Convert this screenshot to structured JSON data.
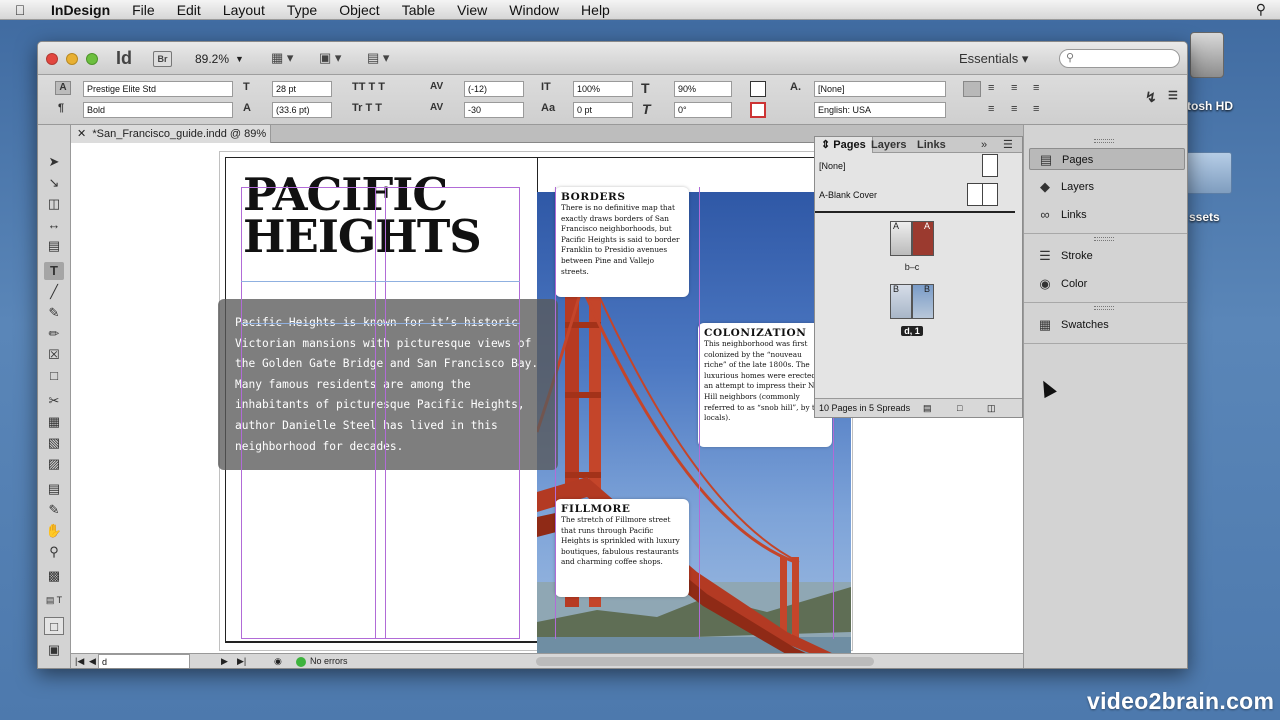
{
  "menubar": {
    "app": "InDesign",
    "items": [
      "File",
      "Edit",
      "Layout",
      "Type",
      "Object",
      "Table",
      "View",
      "Window",
      "Help"
    ]
  },
  "desktop": {
    "hd_label": "tosh HD",
    "folder_label": "ssets",
    "watermark": "video2brain.com"
  },
  "appbar": {
    "logo": "Id",
    "bridge": "Br",
    "zoom": "89.2%",
    "workspace": "Essentials",
    "search_placeholder": ""
  },
  "control": {
    "font_family": "Prestige Elite Std",
    "font_style": "Bold",
    "font_size": "28 pt",
    "leading": "(33.6 pt)",
    "kerning": "(-12)",
    "tracking": "-30",
    "vscale": "100%",
    "baseline": "0 pt",
    "hscale": "90%",
    "skew": "0°",
    "char_style": "[None]",
    "language": "English: USA"
  },
  "document": {
    "tab": "*San_Francisco_guide.indd @ 89%",
    "heading_line1": "PACIFIC",
    "heading_line2": "HEIGHTS",
    "intro": "Pacific Heights is known for it’s historic Victorian mansions with picturesque views of the Golden Gate Bridge and San Francisco Bay. Many famous residents are among the inhabitants of picturesque Pacific Heights, author Danielle Steel has lived in this neighborhood for decades.",
    "callouts": [
      {
        "title": "BORDERS",
        "body": "There is no definitive map that exactly draws borders of San Francisco neighborhoods, but Pacific Heights is said to border Franklin to Presidio avenues between Pine and Vallejo streets."
      },
      {
        "title": "COLONIZATION",
        "body": "This neighborhood was first colonized by the “nouveau riche” of the late 1800s. The luxurious homes were erected in an attempt to impress their Nob Hill neighbors (commonly referred to as “snob hill”, by the locals)."
      },
      {
        "title": "FILLMORE",
        "body": "The stretch of Fillmore street that runs through Pacific Heights is sprinkled with luxury boutiques, fabulous restaurants and charming coffee shops."
      }
    ]
  },
  "status": {
    "page": "d",
    "errors": "No errors"
  },
  "pages_panel": {
    "tabs": [
      "Pages",
      "Layers",
      "Links"
    ],
    "masters": [
      "[None]",
      "A-Blank Cover"
    ],
    "spreads": [
      {
        "letters": [
          "A",
          "A"
        ],
        "label": "b–c"
      },
      {
        "letters": [
          "B",
          "B"
        ],
        "label": "d, 1"
      }
    ],
    "footer": "10 Pages in 5 Spreads"
  },
  "right_panel": {
    "groups": [
      [
        "Pages",
        "Layers",
        "Links"
      ],
      [
        "Stroke",
        "Color"
      ],
      [
        "Swatches"
      ]
    ]
  }
}
